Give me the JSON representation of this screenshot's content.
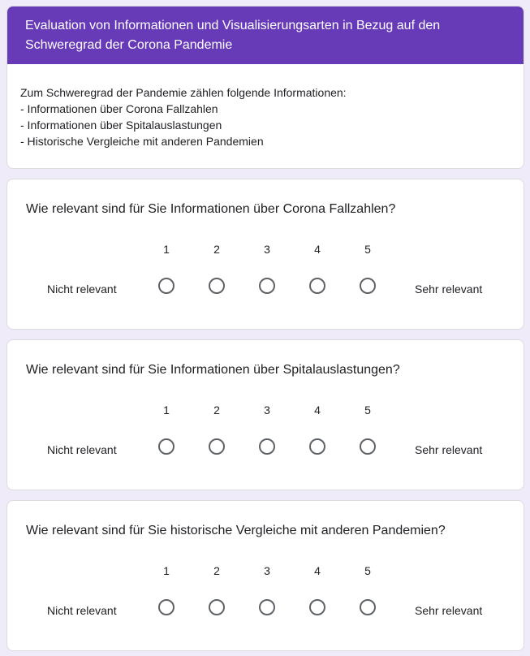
{
  "form": {
    "title": "Evaluation von Informationen und Visualisierungsarten in Bezug auf den Schweregrad der Corona Pandemie",
    "description_lines": [
      "Zum Schweregrad der Pandemie zählen folgende Informationen:",
      "- Informationen über Corona Fallzahlen",
      "- Informationen über Spitalauslastungen",
      "- Historische Vergleiche mit anderen Pandemien"
    ],
    "accent_color": "#673ab7",
    "background_color": "#f0ebf8"
  },
  "questions": [
    {
      "title": "Wie relevant sind für Sie Informationen über Corona Fallzahlen?",
      "scale": [
        "1",
        "2",
        "3",
        "4",
        "5"
      ],
      "low_label": "Nicht relevant",
      "high_label": "Sehr relevant",
      "selected": null
    },
    {
      "title": "Wie relevant sind für Sie Informationen über Spitalauslastungen?",
      "scale": [
        "1",
        "2",
        "3",
        "4",
        "5"
      ],
      "low_label": "Nicht relevant",
      "high_label": "Sehr relevant",
      "selected": null
    },
    {
      "title": "Wie relevant sind für Sie historische Vergleiche mit anderen Pandemien?",
      "scale": [
        "1",
        "2",
        "3",
        "4",
        "5"
      ],
      "low_label": "Nicht relevant",
      "high_label": "Sehr relevant",
      "selected": null
    }
  ]
}
